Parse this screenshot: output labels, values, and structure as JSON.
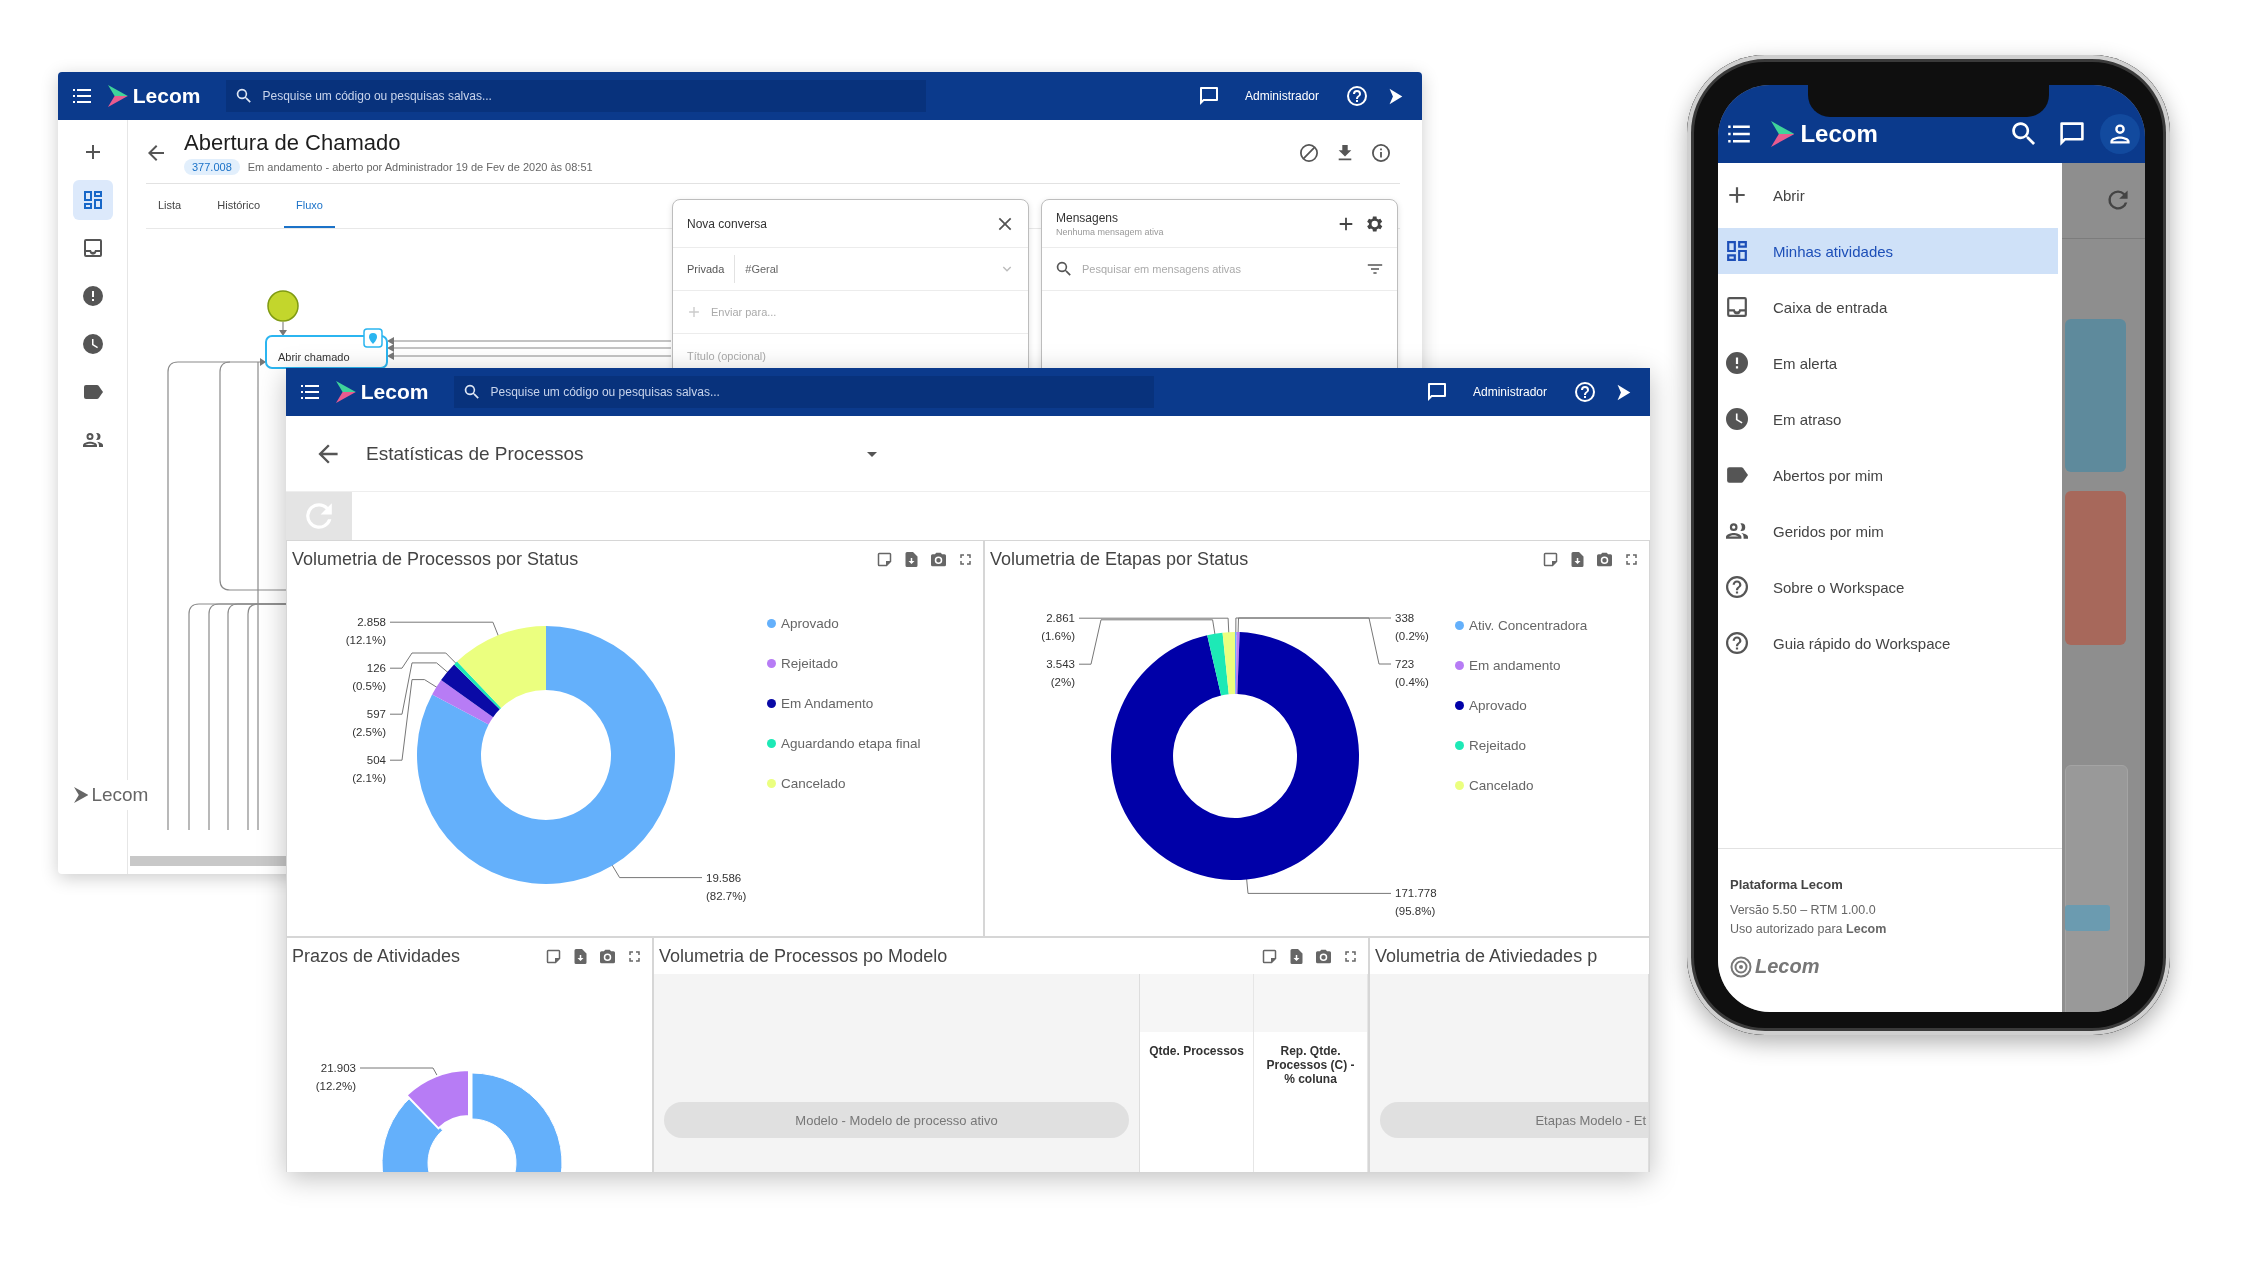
{
  "back_window": {
    "app_bar": {
      "logo": "Lecom",
      "search": {
        "placeholder": "Pesquise um código ou pesquisas salvas..."
      },
      "user": "Administrador"
    },
    "rail": [
      {
        "kind": "add",
        "selected": false
      },
      {
        "kind": "dashboard",
        "selected": true
      },
      {
        "kind": "inbox",
        "selected": false
      },
      {
        "kind": "alert",
        "selected": false
      },
      {
        "kind": "clock",
        "selected": false
      },
      {
        "kind": "tag",
        "selected": false
      },
      {
        "kind": "people",
        "selected": false
      }
    ],
    "rail_logo": "Lecom",
    "title": "Abertura de Chamado",
    "badge": "377.008",
    "subtitle": "Em andamento - aberto por Administrador 19 de Fev de 2020 às 08:51",
    "tabs": [
      {
        "label": "Lista",
        "selected": false
      },
      {
        "label": "Histórico",
        "selected": false
      },
      {
        "label": "Fluxo",
        "selected": true
      }
    ],
    "flow": {
      "task": "Abrir chamado"
    },
    "new_conversation": {
      "title": "Nova conversa",
      "type_label": "Privada",
      "channel": "#Geral",
      "recipient": {
        "placeholder": "Enviar para..."
      },
      "subject": {
        "placeholder": "Título (opcional)"
      }
    },
    "messages": {
      "title": "Mensagens",
      "subtitle": "Nenhuma mensagem ativa",
      "search": {
        "placeholder": "Pesquisar em mensagens ativas"
      }
    }
  },
  "front_window": {
    "app_bar": {
      "logo": "Lecom",
      "search": {
        "placeholder": "Pesquise um código ou pesquisas salvas..."
      },
      "user": "Administrador"
    },
    "title": "Estatísticas de Processos",
    "panels": [
      {
        "kind": "donut",
        "title": "Volumetria de Processos por Status",
        "chart_data": {
          "type": "donut",
          "categories": [
            "Aprovado",
            "Rejeitado",
            "Em Andamento",
            "Aguardando etapa final",
            "Cancelado"
          ],
          "values": [
            82.7,
            2.1,
            2.5,
            0.5,
            12.1
          ],
          "colors": [
            "#64b0fb",
            "#b77cf5",
            "#0a0aa6",
            "#1de9b6",
            "#ebff7f"
          ],
          "value_labels": [
            "19.586\n(82.7%)",
            "504\n(2.1%)",
            "597\n(2.5%)",
            "126\n(0.5%)",
            "2.858\n(12.1%)"
          ],
          "legend": "right"
        }
      },
      {
        "kind": "donut",
        "title": "Volumetria de Etapas por Status",
        "chart_data": {
          "type": "donut",
          "categories": [
            "Ativ. Concentradora",
            "Em andamento",
            "Aprovado",
            "Rejeitado",
            "Cancelado"
          ],
          "values": [
            0.2,
            0.4,
            95.8,
            2,
            1.6
          ],
          "colors": [
            "#64b0fb",
            "#b77cf5",
            "#0000a8",
            "#1de9b6",
            "#ebff7f"
          ],
          "value_labels": [
            "338\n(0.2%)",
            "723\n(0.4%)",
            "171.778\n(95.8%)",
            "3.543\n(2%)",
            "2.861\n(1.6%)"
          ],
          "legend": "right"
        }
      },
      {
        "kind": "partial_donut",
        "title": "Prazos de Atividades",
        "label": "21.903\n(12.2%)"
      },
      {
        "kind": "pivot",
        "title": "Volumetria de Processos po Modelo",
        "row_field": "Modelo - Modelo de processo ativo",
        "columns": [
          "Qtde. Processos",
          "Rep. Qtde. Processos (C) - % coluna"
        ]
      },
      {
        "kind": "pivot",
        "title": "Volumetria de Ativiedades p",
        "row_field": "Etapas Modelo - Et"
      }
    ]
  },
  "phone": {
    "logo": "Lecom",
    "menu": [
      {
        "label": "Abrir",
        "kind": "add",
        "selected": false
      },
      {
        "label": "Minhas atividades",
        "kind": "dashboard",
        "selected": true
      },
      {
        "label": "Caixa de entrada",
        "kind": "inbox",
        "selected": false
      },
      {
        "label": "Em alerta",
        "kind": "alert",
        "selected": false
      },
      {
        "label": "Em atraso",
        "kind": "clock",
        "selected": false
      },
      {
        "label": "Abertos por mim",
        "kind": "tag",
        "selected": false
      },
      {
        "label": "Geridos por mim",
        "kind": "people",
        "selected": false
      },
      {
        "label": "Sobre o Workspace",
        "kind": "help",
        "selected": false
      },
      {
        "label": "Guia rápido do Workspace",
        "kind": "help",
        "selected": false
      }
    ],
    "footer": {
      "product": "Plataforma Lecom",
      "version": "Versão 5.50 – RTM 1.00.0",
      "license": "Uso autorizado para **Lecom**",
      "logo": "Lecom"
    }
  }
}
